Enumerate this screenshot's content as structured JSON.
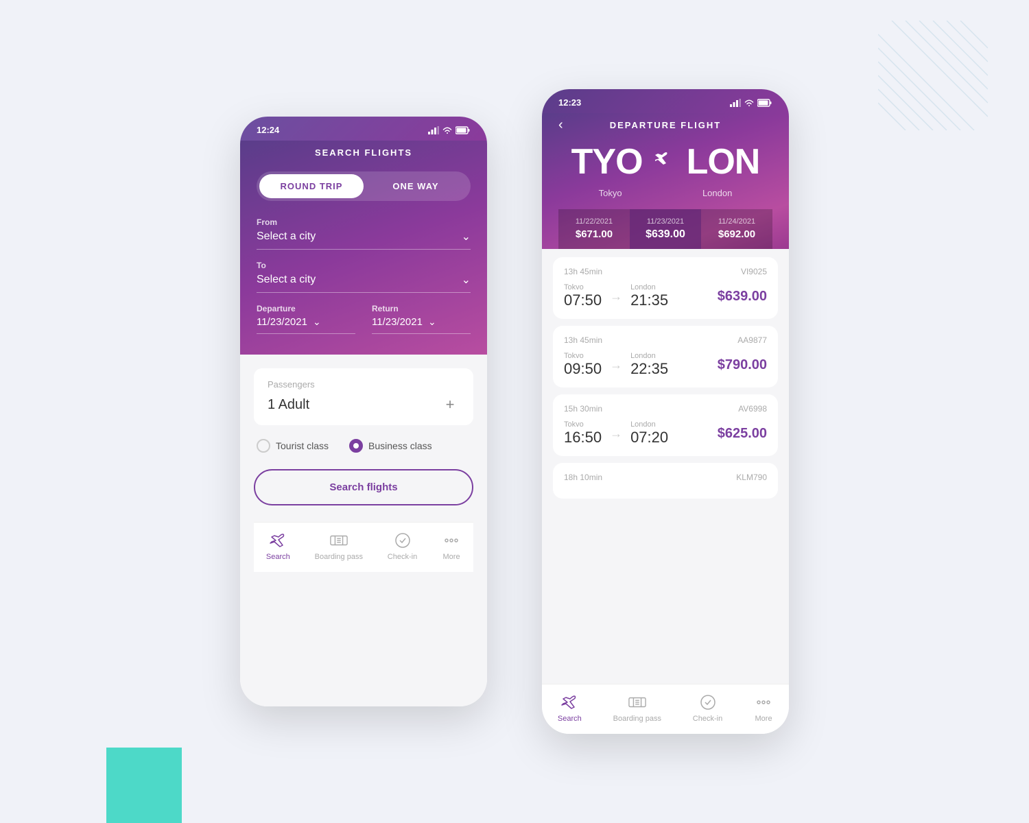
{
  "background": {
    "teal_block": true,
    "lines_decoration": true
  },
  "phone1": {
    "status_bar": {
      "time": "12:24",
      "signal": "▌▌▌",
      "wifi": "wifi",
      "battery": "battery"
    },
    "title": "SEARCH FLIGHTS",
    "trip_types": [
      {
        "label": "ROUND TRIP",
        "active": true
      },
      {
        "label": "ONE WAY",
        "active": false
      }
    ],
    "from_label": "From",
    "from_placeholder": "Select a city",
    "to_label": "To",
    "to_placeholder": "Select a city",
    "departure_label": "Departure",
    "departure_value": "11/23/2021",
    "return_label": "Return",
    "return_value": "11/23/2021",
    "passengers_label": "Passengers",
    "passengers_value": "1 Adult",
    "class_options": [
      {
        "label": "Tourist class",
        "selected": false
      },
      {
        "label": "Business class",
        "selected": true
      }
    ],
    "search_btn": "Search flights",
    "nav": [
      {
        "icon": "plane-icon",
        "label": "Search",
        "active": true
      },
      {
        "icon": "boarding-pass-icon",
        "label": "Boarding pass",
        "active": false
      },
      {
        "icon": "check-in-icon",
        "label": "Check-in",
        "active": false
      },
      {
        "icon": "more-icon",
        "label": "More",
        "active": false
      }
    ]
  },
  "phone2": {
    "status_bar": {
      "time": "12:23"
    },
    "title": "DEPARTURE FLIGHT",
    "route": {
      "from_code": "TYO",
      "from_city": "Tokyo",
      "to_code": "LON",
      "to_city": "London"
    },
    "date_prices": [
      {
        "date": "11/22/2021",
        "price": "$671.00",
        "active": false
      },
      {
        "date": "11/23/2021",
        "price": "$639.00",
        "active": true
      },
      {
        "date": "11/24/2021",
        "price": "$692.00",
        "active": false
      }
    ],
    "flights": [
      {
        "duration": "13h 45min",
        "code": "VI9025",
        "from_city": "Tokvo",
        "from_time": "07:50",
        "to_city": "London",
        "to_time": "21:35",
        "price": "$639.00"
      },
      {
        "duration": "13h 45min",
        "code": "AA9877",
        "from_city": "Tokvo",
        "from_time": "09:50",
        "to_city": "London",
        "to_time": "22:35",
        "price": "$790.00"
      },
      {
        "duration": "15h 30min",
        "code": "AV6998",
        "from_city": "Tokvo",
        "from_time": "16:50",
        "to_city": "London",
        "to_time": "07:20",
        "price": "$625.00"
      },
      {
        "duration": "18h 10min",
        "code": "KLM790",
        "from_city": "",
        "from_time": "",
        "to_city": "",
        "to_time": "",
        "price": ""
      }
    ],
    "nav": [
      {
        "icon": "plane-icon",
        "label": "Search",
        "active": true
      },
      {
        "icon": "boarding-pass-icon",
        "label": "Boarding pass",
        "active": false
      },
      {
        "icon": "check-in-icon",
        "label": "Check-in",
        "active": false
      },
      {
        "icon": "more-icon",
        "label": "More",
        "active": false
      }
    ]
  }
}
